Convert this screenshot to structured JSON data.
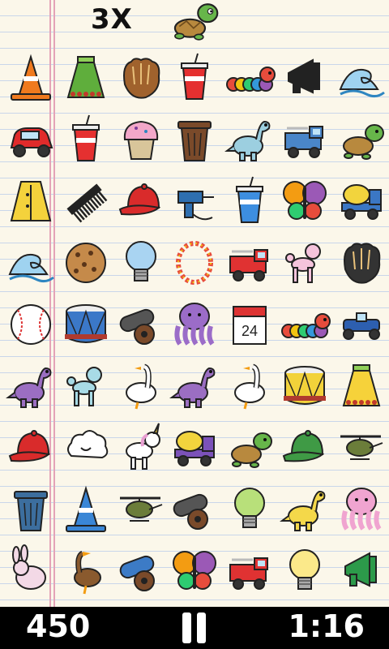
{
  "header": {
    "multiplier": "3X",
    "target_item": "turtle"
  },
  "status_bar": {
    "score": "450",
    "timer": "1:16"
  },
  "colors": {
    "paper": "#fbf7ea",
    "rule_lines": "#c9d6ea",
    "margin_lines": "#e4a3b8",
    "bar": "#000000"
  },
  "grid": {
    "rows": [
      [
        "traffic-cone-orange",
        "skirt-green",
        "baseball-glove",
        "soda-cup",
        "caterpillar",
        "megaphone-black",
        "wave"
      ],
      [
        "car-red",
        "soda-cup",
        "cupcake",
        "trash-can-brown",
        "dinosaur-blue",
        "fire-truck-blue",
        "turtle"
      ],
      [
        "raincoat-yellow",
        "comb",
        "cap-red",
        "drill",
        "soda-cup-blue",
        "butterfly",
        "cement-truck-blue"
      ],
      [
        "wave",
        "cookie",
        "light-bulb-blue",
        "lei",
        "fire-truck-red",
        "poodle",
        "baseball-glove-black"
      ],
      [
        "baseball",
        "drum-blue",
        "cannon",
        "octopus-purple",
        "calendar",
        "caterpillar",
        "race-car"
      ],
      [
        "dinosaur-purple",
        "poodle-blue",
        "goose",
        "dinosaur-purple",
        "goose",
        "drum-yellow",
        "skirt-yellow"
      ],
      [
        "cap-red",
        "cloud",
        "unicorn",
        "cement-truck-purple",
        "turtle",
        "cap-green",
        "helicopter"
      ],
      [
        "trash-can-blue",
        "traffic-cone-blue",
        "helicopter",
        "cannon",
        "light-bulb-green",
        "dinosaur-yellow",
        "octopus-pink"
      ],
      [
        "bunny",
        "duck",
        "cannon-blue",
        "butterfly",
        "fire-truck-red",
        "light-bulb-yellow",
        "megaphone-green"
      ]
    ]
  }
}
